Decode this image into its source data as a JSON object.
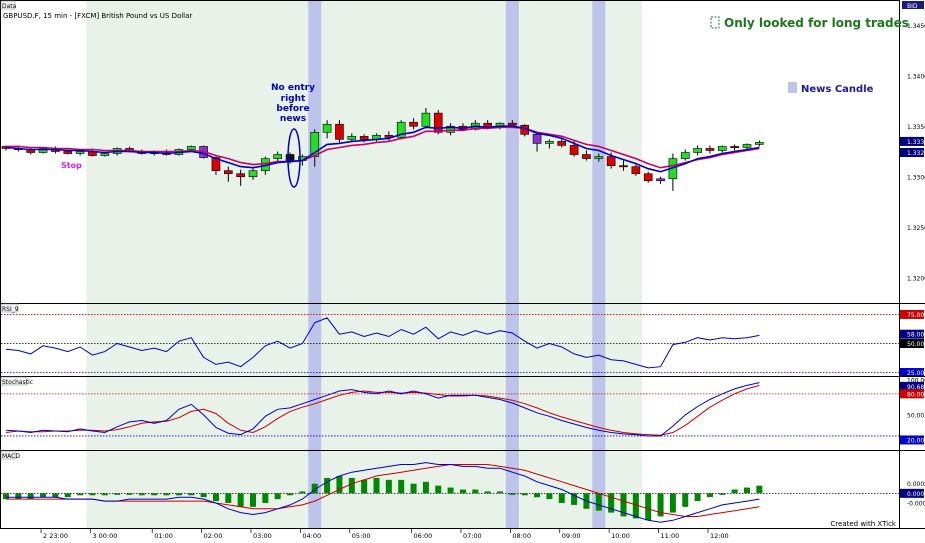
{
  "chart_data": {
    "type": "candlestick",
    "title": "GBPUSD.F, 15 min - [FXCM] British Pound vs US Dollar",
    "panel_labels": [
      "Data",
      "RSI_9",
      "Stochastic",
      "MACD"
    ],
    "price_label": "BID",
    "price_ticks": [
      "1.3450",
      "1.3400",
      "1.3350",
      "1.3300",
      "1.3250",
      "1.3200"
    ],
    "price_current": [
      "1.3333",
      "1.3326"
    ],
    "time_labels": [
      "2 23:00",
      "3 00:00",
      "01:00",
      "02:00",
      "03:00",
      "04:00",
      "05:00",
      "06:00",
      "07:00",
      "08:00",
      "09:00",
      "10:00",
      "11:00",
      "12:00"
    ],
    "candles": [
      [
        1.333,
        1.3331,
        1.3326,
        1.3328
      ],
      [
        1.3328,
        1.333,
        1.3325,
        1.3327
      ],
      [
        1.3327,
        1.3329,
        1.3322,
        1.3324
      ],
      [
        1.3324,
        1.3329,
        1.3323,
        1.3328
      ],
      [
        1.3328,
        1.333,
        1.3323,
        1.3325
      ],
      [
        1.3325,
        1.3327,
        1.3322,
        1.3323
      ],
      [
        1.3323,
        1.3326,
        1.3321,
        1.3325
      ],
      [
        1.3325,
        1.3328,
        1.332,
        1.3321
      ],
      [
        1.3321,
        1.3324,
        1.332,
        1.3323
      ],
      [
        1.3323,
        1.3329,
        1.3321,
        1.3328
      ],
      [
        1.3328,
        1.333,
        1.3324,
        1.3325
      ],
      [
        1.3325,
        1.3327,
        1.3322,
        1.3323
      ],
      [
        1.3323,
        1.3326,
        1.3321,
        1.3324
      ],
      [
        1.3324,
        1.3327,
        1.3321,
        1.3322
      ],
      [
        1.3322,
        1.3328,
        1.3321,
        1.3327
      ],
      [
        1.3327,
        1.3331,
        1.3325,
        1.333
      ],
      [
        1.333,
        1.3331,
        1.3318,
        1.3319
      ],
      [
        1.3319,
        1.332,
        1.3302,
        1.3306
      ],
      [
        1.3306,
        1.331,
        1.3295,
        1.3303
      ],
      [
        1.3303,
        1.3307,
        1.3291,
        1.33
      ],
      [
        1.33,
        1.3308,
        1.3297,
        1.3306
      ],
      [
        1.3306,
        1.332,
        1.3302,
        1.3318
      ],
      [
        1.3318,
        1.3325,
        1.3314,
        1.3322
      ],
      [
        1.3322,
        1.3324,
        1.3313,
        1.3316
      ],
      [
        1.3316,
        1.3322,
        1.3311,
        1.332
      ],
      [
        1.332,
        1.3347,
        1.331,
        1.3344
      ],
      [
        1.3344,
        1.3356,
        1.3338,
        1.3352
      ],
      [
        1.3352,
        1.3356,
        1.3334,
        1.3337
      ],
      [
        1.3337,
        1.3343,
        1.3334,
        1.334
      ],
      [
        1.334,
        1.3342,
        1.3334,
        1.3337
      ],
      [
        1.3337,
        1.3343,
        1.3335,
        1.3341
      ],
      [
        1.3341,
        1.3345,
        1.3336,
        1.3339
      ],
      [
        1.3339,
        1.3356,
        1.3337,
        1.3354
      ],
      [
        1.3354,
        1.3358,
        1.3347,
        1.335
      ],
      [
        1.335,
        1.3368,
        1.3348,
        1.3363
      ],
      [
        1.3363,
        1.3366,
        1.3342,
        1.3344
      ],
      [
        1.3344,
        1.3353,
        1.3341,
        1.335
      ],
      [
        1.335,
        1.3353,
        1.3345,
        1.3347
      ],
      [
        1.3347,
        1.3356,
        1.3346,
        1.3353
      ],
      [
        1.3353,
        1.3356,
        1.3347,
        1.3349
      ],
      [
        1.3349,
        1.3354,
        1.3347,
        1.3353
      ],
      [
        1.3353,
        1.3356,
        1.335,
        1.3351
      ],
      [
        1.3351,
        1.3352,
        1.334,
        1.3342
      ],
      [
        1.3342,
        1.3344,
        1.3325,
        1.3333
      ],
      [
        1.3333,
        1.3337,
        1.3328,
        1.3335
      ],
      [
        1.3335,
        1.3339,
        1.3329,
        1.3331
      ],
      [
        1.3331,
        1.3336,
        1.332,
        1.3322
      ],
      [
        1.3322,
        1.3326,
        1.3316,
        1.3318
      ],
      [
        1.3318,
        1.3323,
        1.3315,
        1.332
      ],
      [
        1.332,
        1.3324,
        1.3308,
        1.3311
      ],
      [
        1.3311,
        1.3316,
        1.3306,
        1.331
      ],
      [
        1.331,
        1.3312,
        1.3301,
        1.3303
      ],
      [
        1.3303,
        1.3305,
        1.3294,
        1.3296
      ],
      [
        1.3296,
        1.33,
        1.3293,
        1.3298
      ],
      [
        1.3298,
        1.3323,
        1.3286,
        1.3318
      ],
      [
        1.3318,
        1.3327,
        1.3316,
        1.3324
      ],
      [
        1.3324,
        1.3331,
        1.3321,
        1.3328
      ],
      [
        1.3328,
        1.3331,
        1.3323,
        1.3326
      ],
      [
        1.3326,
        1.3331,
        1.3324,
        1.333
      ],
      [
        1.333,
        1.3332,
        1.3326,
        1.3329
      ],
      [
        1.3329,
        1.3333,
        1.3327,
        1.3332
      ],
      [
        1.3332,
        1.3336,
        1.333,
        1.3334
      ]
    ],
    "magenta_candles": [
      16,
      43,
      53
    ],
    "black_candles": [
      23
    ],
    "ma_blue": [
      1.3329,
      1.3328,
      1.3327,
      1.3327,
      1.3327,
      1.3326,
      1.3326,
      1.3325,
      1.3324,
      1.3325,
      1.3325,
      1.3324,
      1.3324,
      1.3323,
      1.3324,
      1.3325,
      1.3323,
      1.3318,
      1.3314,
      1.331,
      1.3309,
      1.3311,
      1.3314,
      1.3315,
      1.3316,
      1.3324,
      1.3332,
      1.3333,
      1.3335,
      1.3336,
      1.3337,
      1.3338,
      1.3342,
      1.3344,
      1.3349,
      1.3348,
      1.3349,
      1.3348,
      1.335,
      1.3349,
      1.335,
      1.335,
      1.3348,
      1.3343,
      1.3341,
      1.3338,
      1.3333,
      1.3328,
      1.3326,
      1.3321,
      1.3317,
      1.3313,
      1.3308,
      1.3305,
      1.3309,
      1.3313,
      1.3318,
      1.332,
      1.3323,
      1.3325,
      1.3327,
      1.3329
    ],
    "ma_red": [
      1.333,
      1.333,
      1.3329,
      1.3329,
      1.3328,
      1.3328,
      1.3327,
      1.3327,
      1.3326,
      1.3326,
      1.3326,
      1.3325,
      1.3325,
      1.3325,
      1.3325,
      1.3326,
      1.3325,
      1.3321,
      1.3318,
      1.3314,
      1.3312,
      1.3313,
      1.3315,
      1.3315,
      1.3316,
      1.3321,
      1.3327,
      1.3329,
      1.3331,
      1.3332,
      1.3334,
      1.3335,
      1.3338,
      1.334,
      1.3345,
      1.3345,
      1.3346,
      1.3346,
      1.3348,
      1.3348,
      1.3349,
      1.3349,
      1.3348,
      1.3344,
      1.3342,
      1.334,
      1.3336,
      1.3332,
      1.333,
      1.3326,
      1.3322,
      1.3318,
      1.3313,
      1.3309,
      1.3311,
      1.3314,
      1.3317,
      1.3319,
      1.3322,
      1.3324,
      1.3326,
      1.3328
    ],
    "rsi": [
      45,
      44,
      41,
      48,
      46,
      43,
      47,
      40,
      43,
      50,
      47,
      44,
      46,
      43,
      52,
      55,
      38,
      32,
      34,
      30,
      38,
      48,
      52,
      46,
      50,
      68,
      72,
      58,
      60,
      56,
      59,
      56,
      62,
      58,
      64,
      54,
      60,
      57,
      61,
      58,
      61,
      59,
      52,
      46,
      50,
      47,
      41,
      38,
      40,
      36,
      35,
      32,
      29,
      30,
      49,
      51,
      55,
      53,
      55,
      54,
      55,
      57
    ],
    "rsi_ticks": [
      "75.00",
      "58.00",
      "50.00",
      "25.00"
    ],
    "stoch_k": [
      28,
      27,
      25,
      28,
      27,
      26,
      30,
      27,
      25,
      33,
      40,
      42,
      38,
      42,
      58,
      65,
      50,
      32,
      24,
      22,
      30,
      48,
      58,
      60,
      66,
      72,
      78,
      84,
      86,
      82,
      80,
      84,
      80,
      84,
      80,
      74,
      78,
      78,
      78,
      75,
      72,
      67,
      60,
      53,
      48,
      42,
      37,
      32,
      28,
      25,
      23,
      22,
      20,
      20,
      34,
      50,
      62,
      72,
      80,
      87,
      92,
      96
    ],
    "stoch_d": [
      25,
      27,
      26,
      26,
      27,
      27,
      28,
      28,
      27,
      29,
      33,
      38,
      40,
      41,
      46,
      55,
      58,
      52,
      38,
      28,
      25,
      33,
      45,
      55,
      61,
      66,
      72,
      78,
      82,
      84,
      82,
      82,
      81,
      82,
      81,
      79,
      77,
      77,
      78,
      77,
      74,
      71,
      66,
      60,
      53,
      47,
      42,
      37,
      32,
      28,
      25,
      23,
      22,
      21,
      25,
      35,
      48,
      61,
      71,
      80,
      87,
      92
    ],
    "stoch_ticks": [
      "100.00",
      "90.68",
      "80.00",
      "50.00",
      "20.00",
      "20.00"
    ],
    "macd_hist": [
      -0.0003,
      -0.0003,
      -0.0003,
      -0.0002,
      -0.0002,
      -0.0002,
      -0.0001,
      -0.0001,
      -0.0001,
      0,
      0,
      -0.0001,
      -0.0001,
      -0.0001,
      -0.0001,
      -0.0001,
      -0.0002,
      -0.0004,
      -0.0005,
      -0.0007,
      -0.0007,
      -0.0005,
      -0.0003,
      -0.0001,
      0.0001,
      0.0005,
      0.0008,
      0.0009,
      0.0008,
      0.0007,
      0.0008,
      0.0007,
      0.0007,
      0.0005,
      0.0006,
      0.0004,
      0.0003,
      0.0002,
      0.0002,
      0.0001,
      0.0001,
      0,
      -0.0001,
      -0.0002,
      -0.0003,
      -0.0005,
      -0.0006,
      -0.0008,
      -0.0009,
      -0.001,
      -0.0012,
      -0.0013,
      -0.0014,
      -0.0012,
      -0.001,
      -0.0007,
      -0.0004,
      -0.0002,
      0,
      0.0002,
      0.0003,
      0.0004
    ],
    "macd_line": [
      -0.0002,
      -0.0002,
      -0.0002,
      -0.0002,
      -0.0002,
      -0.0003,
      -0.0003,
      -0.0003,
      -0.0004,
      -0.0004,
      -0.0003,
      -0.0003,
      -0.0003,
      -0.0003,
      -0.0002,
      -0.0002,
      -0.0003,
      -0.0005,
      -0.0008,
      -0.001,
      -0.0011,
      -0.001,
      -0.0008,
      -0.0006,
      -0.0003,
      0.0002,
      0.0006,
      0.0009,
      0.0011,
      0.0012,
      0.0013,
      0.0014,
      0.0015,
      0.0015,
      0.0016,
      0.0015,
      0.0015,
      0.0014,
      0.0014,
      0.0013,
      0.0013,
      0.0011,
      0.0009,
      0.0006,
      0.0004,
      0.0002,
      -0.0001,
      -0.0004,
      -0.0006,
      -0.0008,
      -0.001,
      -0.0012,
      -0.0014,
      -0.0015,
      -0.0014,
      -0.0012,
      -0.001,
      -0.0008,
      -0.0006,
      -0.0005,
      -0.0004,
      -0.0003
    ],
    "macd_signal": [
      -0.0003,
      -0.0003,
      -0.0003,
      -0.0003,
      -0.0003,
      -0.0003,
      -0.0003,
      -0.0003,
      -0.0004,
      -0.0004,
      -0.0004,
      -0.0004,
      -0.0004,
      -0.0004,
      -0.0004,
      -0.0004,
      -0.0004,
      -0.0005,
      -0.0006,
      -0.0007,
      -0.0008,
      -0.0008,
      -0.0008,
      -0.0007,
      -0.0006,
      -0.0004,
      -0.0001,
      0.0002,
      0.0005,
      0.0007,
      0.0009,
      0.001,
      0.0011,
      0.0012,
      0.0013,
      0.0014,
      0.0015,
      0.0015,
      0.0015,
      0.0015,
      0.0014,
      0.0013,
      0.0012,
      0.001,
      0.0008,
      0.0006,
      0.0004,
      0.0002,
      0,
      -0.0002,
      -0.0004,
      -0.0006,
      -0.0008,
      -0.001,
      -0.0011,
      -0.0012,
      -0.0012,
      -0.0011,
      -0.001,
      -0.0009,
      -0.0008,
      -0.0007
    ],
    "macd_ticks": [
      "0.0005",
      "0.0000",
      "-0.0005"
    ],
    "news_candles": [
      25,
      41,
      48
    ],
    "green_zone_candles": [
      7,
      51
    ],
    "annotations": {
      "legend_rect_label": "Only looked for long trades",
      "news_legend": "News Candle",
      "no_entry": [
        "No entry",
        "right",
        "before",
        "news"
      ],
      "stop": "Stop",
      "credit": "Created with XTick"
    },
    "colors": {
      "bull": "#22dd22",
      "bear": "#dd0000",
      "news": "#bcc4ec",
      "zone": "#e8f2e8",
      "zone_text": "#1a7a1a",
      "blue": "#0000cc",
      "magenta": "#cc0066",
      "macd_hist": "#008800",
      "purple": "#8833cc",
      "price_highlight": "#000080"
    }
  }
}
